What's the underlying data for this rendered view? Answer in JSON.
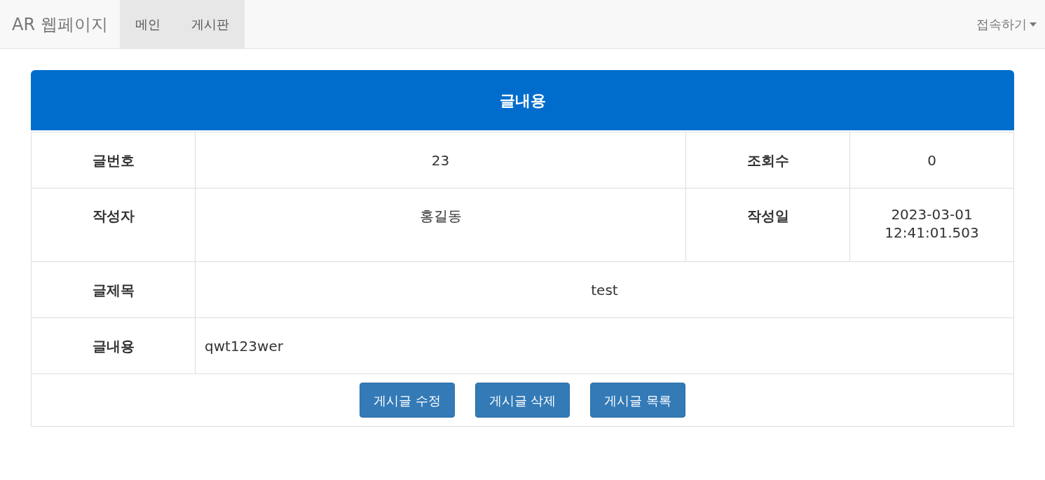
{
  "navbar": {
    "brand": "AR 웹페이지",
    "items": [
      {
        "label": "메인",
        "selected": true
      },
      {
        "label": "게시판",
        "selected": true
      }
    ],
    "account": "접속하기"
  },
  "panel": {
    "title": "글내용",
    "rows": [
      [
        {
          "kind": "label",
          "text": "글번호"
        },
        {
          "kind": "value",
          "text": "23"
        },
        {
          "kind": "label",
          "text": "조회수"
        },
        {
          "kind": "value",
          "text": "0"
        }
      ],
      [
        {
          "kind": "label",
          "text": "작성자"
        },
        {
          "kind": "value",
          "text": "홍길동"
        },
        {
          "kind": "label",
          "text": "작성일"
        },
        {
          "kind": "value",
          "text": "2023-03-01 12:41:01.503"
        }
      ],
      [
        {
          "kind": "label",
          "text": "글제목"
        },
        {
          "kind": "wide",
          "text": "test",
          "colspan": 3
        }
      ],
      [
        {
          "kind": "label",
          "text": "글내용"
        },
        {
          "kind": "content",
          "text": "qwt123wer",
          "colspan": 3
        }
      ]
    ],
    "buttons": [
      "게시글 수정",
      "게시글 삭제",
      "게시글 목록"
    ]
  }
}
